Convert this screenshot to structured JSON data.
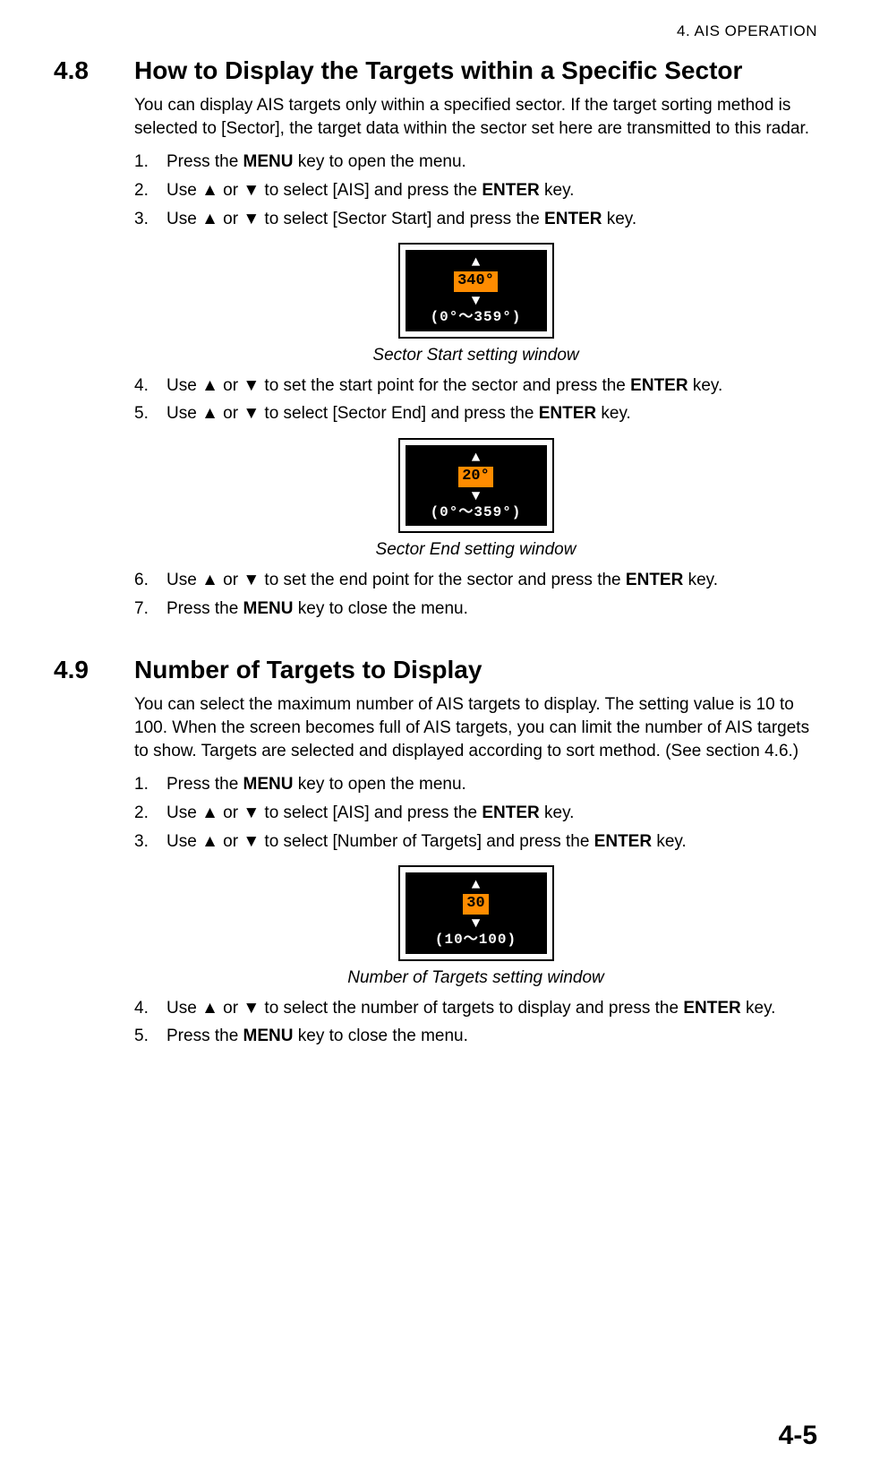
{
  "header": {
    "chapter": "4.  AIS OPERATION"
  },
  "s48": {
    "num": "4.8",
    "title": "How to Display the Targets within a Specific Sec­tor",
    "intro": "You can display AIS targets only within a specified sector. If the target sorting method is selected to [Sector], the target data within the sector set here are transmitted to this radar.",
    "steps": {
      "s1": {
        "n": "1.",
        "a": "Press the ",
        "b": "MENU",
        "c": " key to open the menu."
      },
      "s2": {
        "n": "2.",
        "a": "Use ",
        "b": " or ",
        "c": " to select [AIS] and press the ",
        "d": "ENTER",
        "e": " key."
      },
      "s3": {
        "n": "3.",
        "a": "Use ",
        "b": " or ",
        "c": " to select [Sector Start] and press the ",
        "d": "ENTER",
        "e": " key."
      },
      "s4": {
        "n": "4.",
        "a": "Use ",
        "b": " or ",
        "c": " to set the start point for the sector and press the ",
        "d": "ENTER",
        "e": " key."
      },
      "s5": {
        "n": "5.",
        "a": "Use ",
        "b": " or ",
        "c": " to select [Sector End] and press the ",
        "d": "ENTER",
        "e": " key."
      },
      "s6": {
        "n": "6.",
        "a": "Use ",
        "b": " or ",
        "c": " to set the end point for the sector and press the ",
        "d": "ENTER",
        "e": " key."
      },
      "s7": {
        "n": "7.",
        "a": "Press the ",
        "b": "MENU",
        "c": " key to close the menu."
      }
    },
    "fig1": {
      "value": "340°",
      "range": "(0°～359°)",
      "caption": "Sector Start setting window"
    },
    "fig2": {
      "value": "20°",
      "range": "(0°～359°)",
      "caption": "Sector End setting window"
    }
  },
  "s49": {
    "num": "4.9",
    "title": "Number of Targets to Display",
    "intro": "You can select the maximum number of AIS targets to display. The setting value is 10 to 100. When the screen becomes full of AIS targets, you can limit the number of AIS targets to show. Targets are selected and displayed according to sort method. (See section 4.6.)",
    "steps": {
      "s1": {
        "n": "1.",
        "a": "Press the ",
        "b": "MENU",
        "c": " key to open the menu."
      },
      "s2": {
        "n": "2.",
        "a": "Use ",
        "b": " or ",
        "c": " to select [AIS] and press the ",
        "d": "ENTER",
        "e": " key."
      },
      "s3": {
        "n": "3.",
        "a": "Use ",
        "b": " or ",
        "c": " to select [Number of Targets] and press the ",
        "d": "ENTER",
        "e": " key."
      },
      "s4": {
        "n": "4.",
        "a": "Use ",
        "b": " or ",
        "c": " to select the number of targets to display and press the ",
        "d": "ENTER",
        "e": " key."
      },
      "s5": {
        "n": "5.",
        "a": "Press the ",
        "b": "MENU",
        "c": " key to close the menu."
      }
    },
    "fig": {
      "value": "30",
      "range": "(10～100)",
      "caption": "Number of Targets setting window"
    }
  },
  "footer": {
    "page": "4-5"
  }
}
